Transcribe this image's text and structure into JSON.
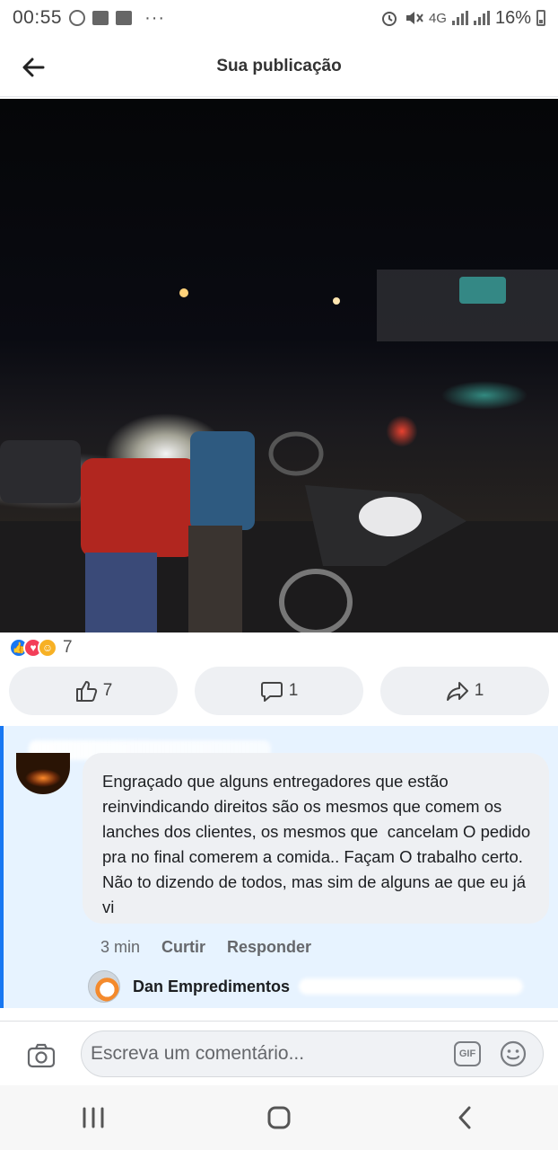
{
  "status_bar": {
    "time": "00:55",
    "left_icons": [
      "facebook-icon",
      "image-icon",
      "voicemail-icon"
    ],
    "more_indicator": "···",
    "network": "4G",
    "battery": "16%"
  },
  "header": {
    "title": "Sua publicação",
    "back_icon": "arrow-left-icon"
  },
  "post": {
    "photo_alt": "photo",
    "reactions": {
      "icons": [
        "like-icon",
        "love-icon",
        "care-icon"
      ],
      "count": "7"
    },
    "actions": {
      "like_count": "7",
      "comment_count": "1",
      "share_count": "1"
    }
  },
  "comment": {
    "text": "Engraçado que alguns entregadores que estão reinvindicando direitos são os mesmos que comem os lanches dos clientes, os mesmos que  cancelam O pedido pra no final comerem a comida.. Façam O trabalho certo. Não to dizendo de todos, mas sim de alguns ae que eu já vi",
    "time": "3 min",
    "like_label": "Curtir",
    "reply_label": "Responder",
    "reply_author": "Dan Empredimentos"
  },
  "composer": {
    "placeholder": "Escreva um comentário...",
    "gif_label": "GIF"
  },
  "colors": {
    "accent": "#1877f2",
    "comment_highlight": "#e7f3ff",
    "button_bg": "#eef0f3"
  }
}
